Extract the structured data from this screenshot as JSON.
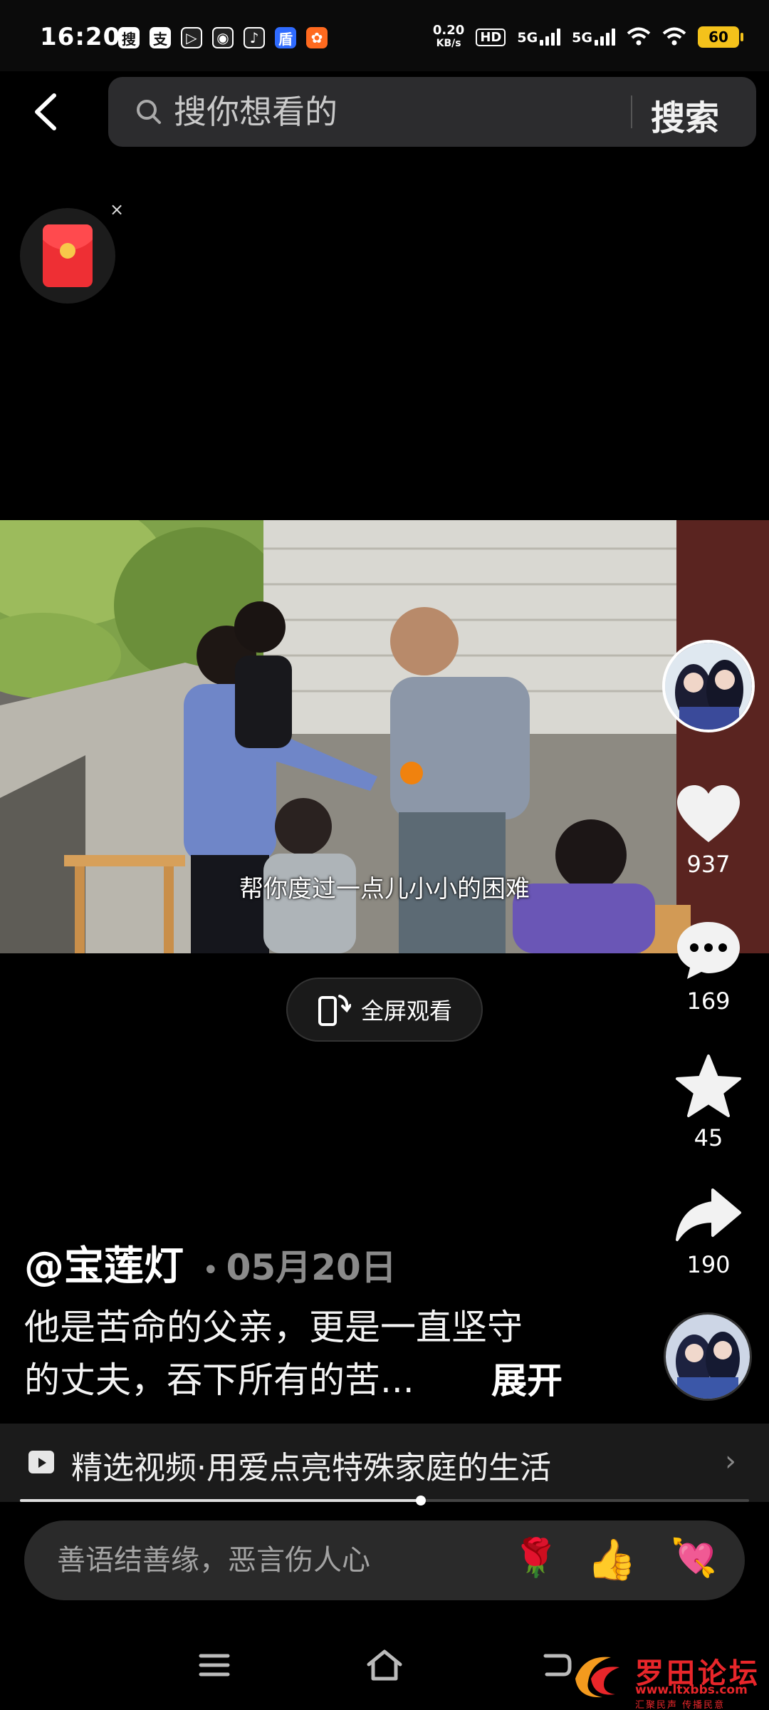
{
  "status_bar": {
    "time": "16:20",
    "net_speed_value": "0.20",
    "net_speed_unit": "KB/s",
    "hd_label": "HD",
    "signal1_label": "5G",
    "signal2_label": "5G",
    "battery": "60",
    "app_icons": [
      "搜",
      "支",
      "▷",
      "◉",
      "♪",
      "盾",
      "✿"
    ]
  },
  "header": {
    "search_placeholder": "搜你想看的",
    "search_button": "搜索"
  },
  "red_packet": {
    "close_label": "×"
  },
  "video": {
    "subtitle": "帮你度过一点儿小小的困难"
  },
  "fullscreen_label": "全屏观看",
  "actions": {
    "like_count": "937",
    "comment_count": "169",
    "favorite_count": "45",
    "share_count": "190"
  },
  "post": {
    "author": "@宝莲灯",
    "date": "05月20日",
    "description_line1": "他是苦命的父亲，更是一直坚守",
    "description_line2": "的丈夫，吞下所有的苦...",
    "expand_label": "展开"
  },
  "collection": {
    "title": "精选视频·用爱点亮特殊家庭的生活",
    "progress_fraction": 0.55
  },
  "comment": {
    "placeholder": "善语结善缘，恶言伤人心",
    "emojis": [
      "🌹",
      "👍",
      "💘"
    ]
  },
  "watermark": {
    "title": "罗田论坛",
    "subtitle": "www.ltxbbs.com",
    "tagline": "汇聚民声 传播民意"
  },
  "colors": {
    "background": "#000000",
    "accent_red": "#ee2f34",
    "battery": "#f4c21b",
    "search_box": "#2c2c2e"
  }
}
